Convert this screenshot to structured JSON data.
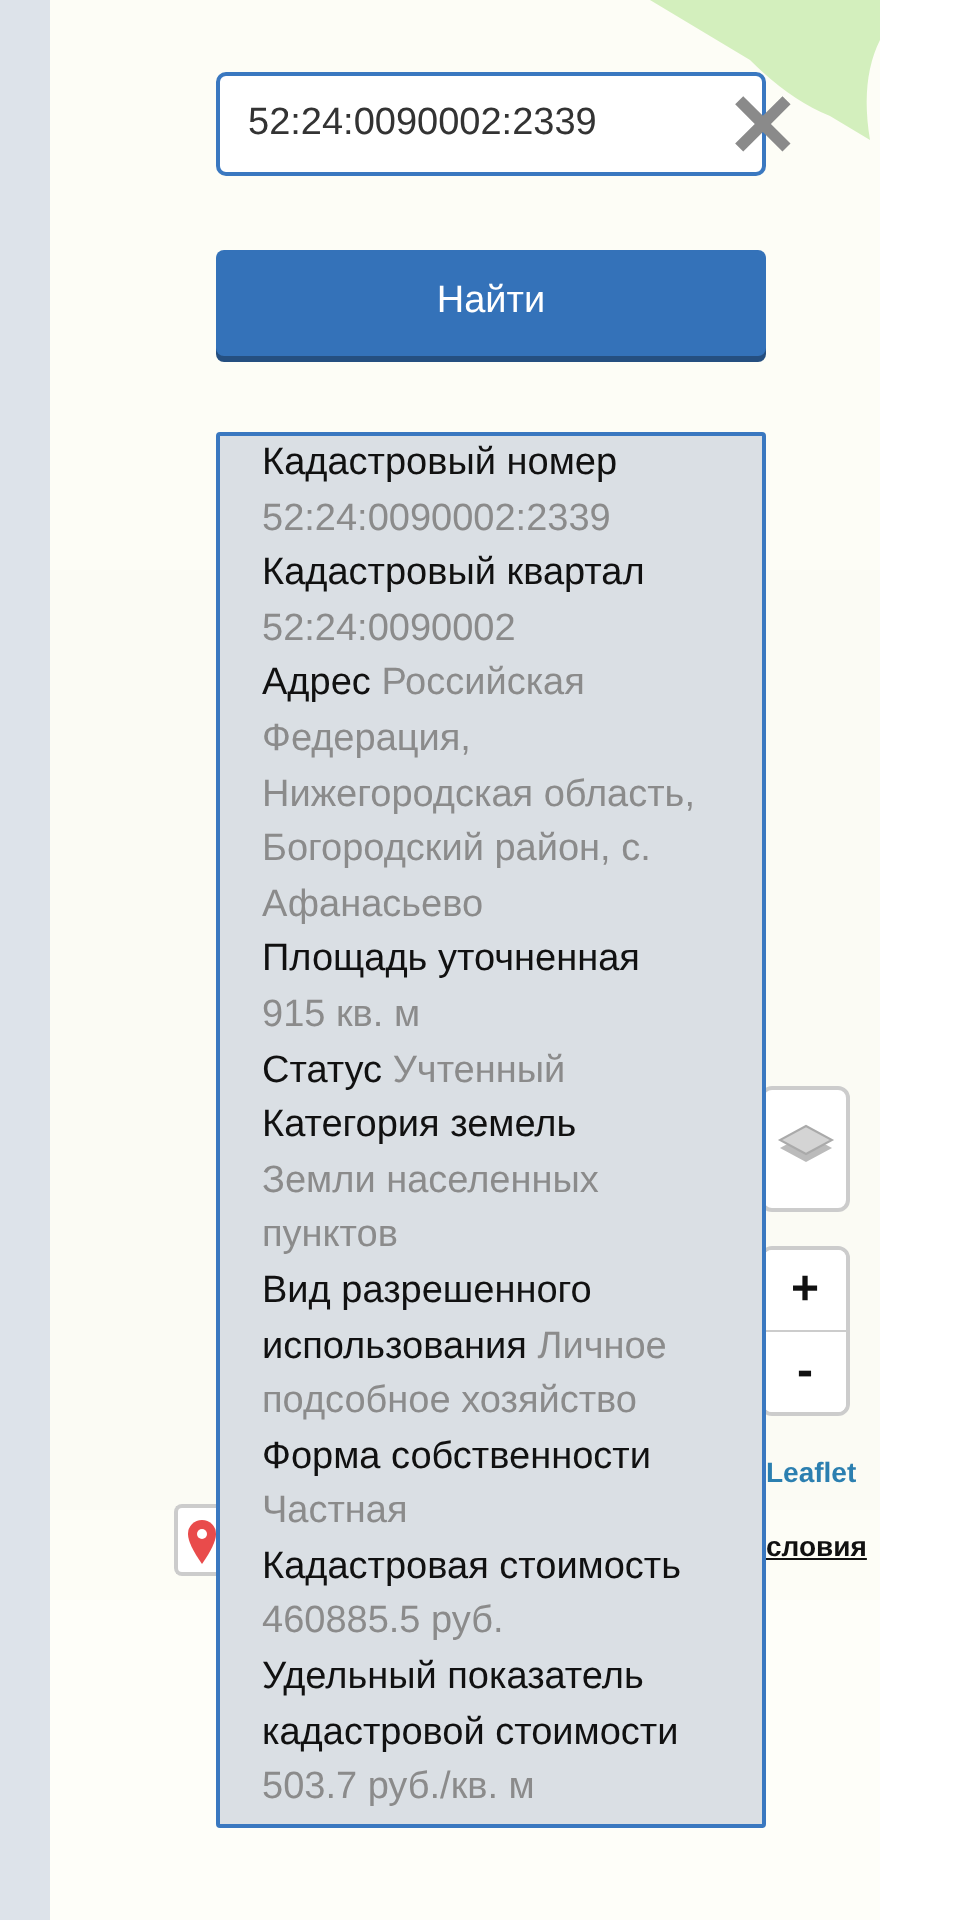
{
  "search": {
    "value": "52:24:0090002:2339",
    "clear": "✕"
  },
  "find_button": {
    "label": "Найти"
  },
  "info": [
    {
      "kind": "block",
      "label": "Кадастровый номер",
      "value": "52:24:0090002:2339"
    },
    {
      "kind": "block",
      "label": "Кадастровый квартал",
      "value": "52:24:0090002"
    },
    {
      "kind": "inline",
      "label": "Адрес",
      "value": "Российская Федерация, Нижегородская область, Богородский район, с. Афанасьево"
    },
    {
      "kind": "block",
      "label": "Площадь уточненная",
      "value": "915 кв. м"
    },
    {
      "kind": "inline",
      "label": "Статус",
      "value": "Учтенный"
    },
    {
      "kind": "block",
      "label": "Категория земель",
      "value": "Земли населенных пунктов"
    },
    {
      "kind": "inline",
      "label": "Вид разрешенного использования",
      "value": "Личное подсобное хозяйство"
    },
    {
      "kind": "block",
      "label": "Форма собственности",
      "value": "Частная"
    },
    {
      "kind": "block",
      "label": "Кадастровая стоимость",
      "value": "460885.5 руб."
    },
    {
      "kind": "block",
      "label": "Удельный показатель кадастровой стоимости",
      "value": "503.7 руб./кв. м"
    }
  ],
  "map": {
    "zoom_in": "+",
    "zoom_out": "-",
    "attribution": "Leaflet",
    "link": "словия"
  }
}
